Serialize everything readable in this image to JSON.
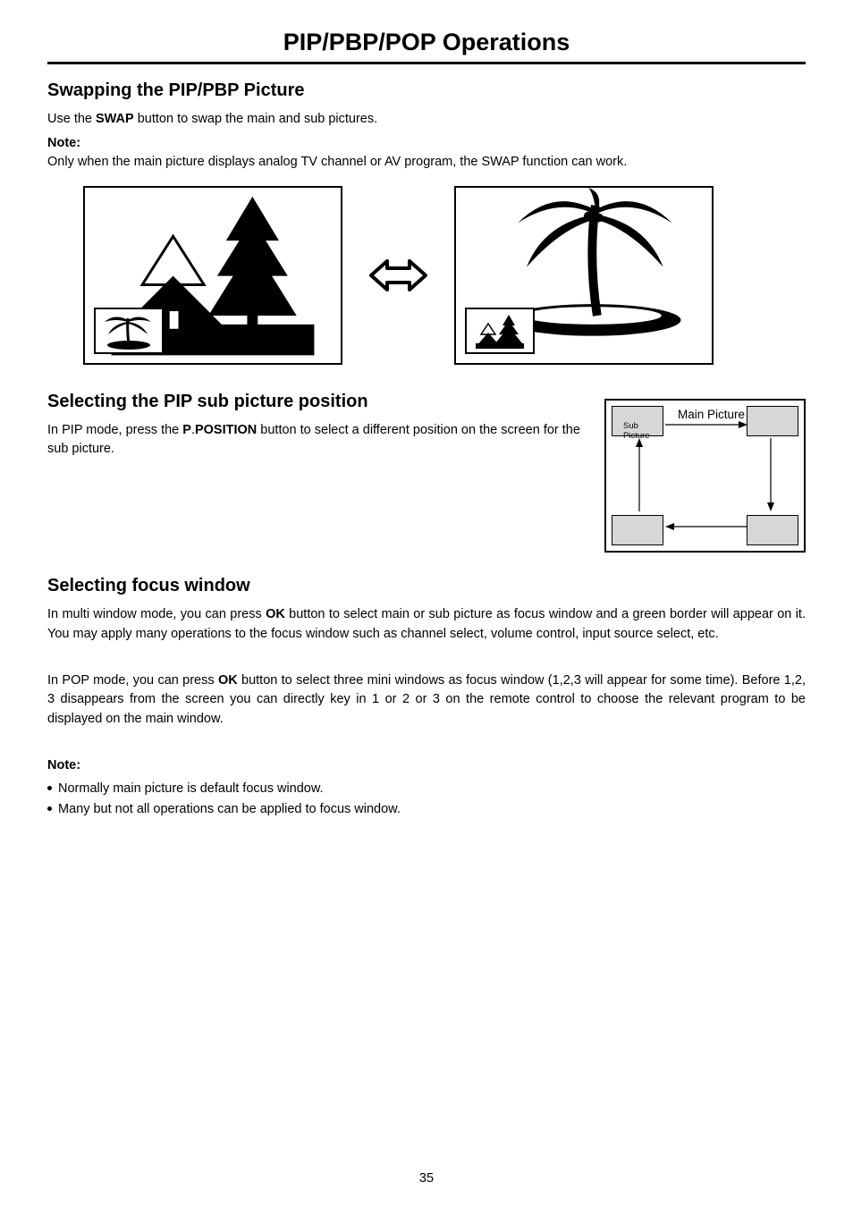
{
  "page": {
    "title": "PIP/PBP/POP Operations",
    "number": "35"
  },
  "swap": {
    "heading": "Swapping the PIP/PBP Picture",
    "line_pre": "Use the ",
    "line_bold": "SWAP",
    "line_post": " button to swap the main and sub pictures.",
    "note_label": "Note",
    "note_text": "Only when the main picture displays analog TV channel or AV program, the SWAP function can work."
  },
  "position": {
    "heading": "Selecting the PIP sub picture position",
    "line_a": "In PIP mode, press the ",
    "line_b": "P",
    "line_dot": ".",
    "line_c": "POSITION",
    "line_d": " button to select a different position on the screen for the sub picture.",
    "main_label": "Main Picture",
    "sub_label": "Sub Picture"
  },
  "focus": {
    "heading": "Selecting focus window",
    "p1_a": "In multi window mode, you can press ",
    "p1_b": "OK",
    "p1_c": " button to select main or sub picture as focus window and a green border will appear on it. You may apply many operations to the focus window such as channel select, volume control, input source select, etc.",
    "p2_a": "In POP mode, you can press ",
    "p2_b": "OK",
    "p2_c": " button to select three mini windows as focus window (1,2,3 will appear for some time). Before 1,2, 3 disappears from the screen you can directly key in 1 or 2 or 3 on the remote control to choose the relevant program to be displayed on the main window.",
    "note_label": "Note",
    "bullet1": "Normally main picture is default focus window.",
    "bullet2": "Many but not all operations can be applied to focus window."
  }
}
